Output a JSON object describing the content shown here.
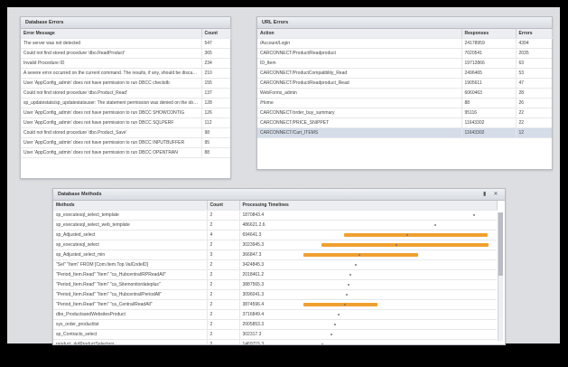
{
  "database_errors": {
    "title": "Database Errors",
    "columns": [
      "Error Message",
      "Count"
    ],
    "rows": [
      {
        "message": "The server was not detected",
        "count": "547"
      },
      {
        "message": "Could not find stored procedure 'dbo.ReadProduct'",
        "count": "365"
      },
      {
        "message": "Invalid Procedure ID",
        "count": "234"
      },
      {
        "message": "A severe error occurred on the current command. The results, if any, should be discarded",
        "count": "210"
      },
      {
        "message": "User 'AppConfig_admin' does not have permission to run DBCC checkdb",
        "count": "155"
      },
      {
        "message": "Could not find stored procedure 'dbo.Product_Read'",
        "count": "137"
      },
      {
        "message": "sp_updatestats/sp_updatestatsuser: The statement permission was denied on the object",
        "count": "128"
      },
      {
        "message": "User 'AppConfig_admin' does not have permission to run DBCC SHOWCONTIG",
        "count": "126"
      },
      {
        "message": "User 'AppConfig_admin' does not have permission to run DBCC SQLPERF",
        "count": "112"
      },
      {
        "message": "Could not find stored procedure 'dbo.Product_Save'",
        "count": "98"
      },
      {
        "message": "User 'AppConfig_admin' does not have permission to run DBCC INPUTBUFFER",
        "count": "95"
      },
      {
        "message": "User 'AppConfig_admin' does not have permission to run DBCC OPENTRAN",
        "count": "88"
      }
    ]
  },
  "url_errors": {
    "title": "URL Errors",
    "columns": [
      "Action",
      "Responses",
      "Errors"
    ],
    "rows": [
      {
        "action": "/Account/Login",
        "responses": "24178959",
        "errors": "4394"
      },
      {
        "action": "CARCONNECT/Product/Readproduct",
        "responses": "7020541",
        "errors": "2035"
      },
      {
        "action": "ID_Item",
        "responses": "19712866",
        "errors": "63"
      },
      {
        "action": "CARCONNECT/ProductCompatiblity_Read",
        "responses": "2496465",
        "errors": "53"
      },
      {
        "action": "CARCONNECT/Product/Readproduct_Read",
        "responses": "1905611",
        "errors": "47"
      },
      {
        "action": "WebForms_admin",
        "responses": "6060463",
        "errors": "28"
      },
      {
        "action": "/Home",
        "responses": "88",
        "errors": "26"
      },
      {
        "action": "CARCONNECT/order_buy_summary",
        "responses": "95116",
        "errors": "22"
      },
      {
        "action": "CARCONNECT/PRICE_SNIPPET",
        "responses": "11643302",
        "errors": "22"
      },
      {
        "action": "CARCONNECT/Cart_ITEMS",
        "responses": "11643302",
        "errors": "12"
      }
    ]
  },
  "database_methods": {
    "title": "Database Methods",
    "columns": [
      "Methods",
      "Count",
      "Processing Timelines"
    ],
    "rows": [
      {
        "method": "sp_executesql_select_template",
        "count": "2",
        "timeline": "1870843.4",
        "bar": null,
        "dot": 0.92
      },
      {
        "method": "sp_executesql_select_web_template",
        "count": "2",
        "timeline": "486621.2.6",
        "bar": null,
        "dot": 0.71
      },
      {
        "method": "sp_Adjusted_select",
        "count": "4",
        "timeline": "694641.3",
        "bar": [
          0.22,
          1.0
        ],
        "dot": 0.56
      },
      {
        "method": "sp_executesql_select",
        "count": "2",
        "timeline": "3023945.3",
        "bar": [
          0.1,
          1.0
        ],
        "dot": 0.5
      },
      {
        "method": "sp_Adjusted_select_min",
        "count": "3",
        "timeline": "366847.3",
        "bar": [
          0.0,
          0.62
        ],
        "dot": 0.3
      },
      {
        "method": "\"Sel\" \"Item\" FROM [Com.Item.Top.ValCodeID]",
        "count": "2",
        "timeline": "3424845.3",
        "bar": null,
        "dot": 0.28
      },
      {
        "method": "\"Period_Item.Read\" \"Item\" \"ca_Hubcentral/RPReadAll\"",
        "count": "2",
        "timeline": "2018461.2",
        "bar": null,
        "dot": 0.25
      },
      {
        "method": "\"Period_Item.Read\" \"Item\" \"ca_Sitemonitordateplus\"",
        "count": "2",
        "timeline": "3887565.3",
        "bar": null,
        "dot": 0.24
      },
      {
        "method": "\"Period_Item.Read\" \"Item\" \"ca_Hubcentral/PeriodAll\"",
        "count": "2",
        "timeline": "3096041.3",
        "bar": null,
        "dot": 0.23
      },
      {
        "method": "\"Period_Item.Read\" \"Item\" \"ca_Central/ReadAll\"",
        "count": "2",
        "timeline": "3874596.4",
        "bar": [
          0.0,
          0.4
        ],
        "dot": 0.22
      },
      {
        "method": "dbo_ProductsandWebsitesProduct",
        "count": "2",
        "timeline": "3716849.4",
        "bar": null,
        "dot": 0.19
      },
      {
        "method": "sys_order_productlist",
        "count": "2",
        "timeline": "2005853.3",
        "bar": null,
        "dot": 0.17
      },
      {
        "method": "sp_Contracts_select",
        "count": "2",
        "timeline": "302317.3",
        "bar": null,
        "dot": 0.15
      },
      {
        "method": "product_rkdProductSelectors",
        "count": "2",
        "timeline": "1469715.3",
        "bar": null,
        "dot": 0.1
      }
    ]
  }
}
